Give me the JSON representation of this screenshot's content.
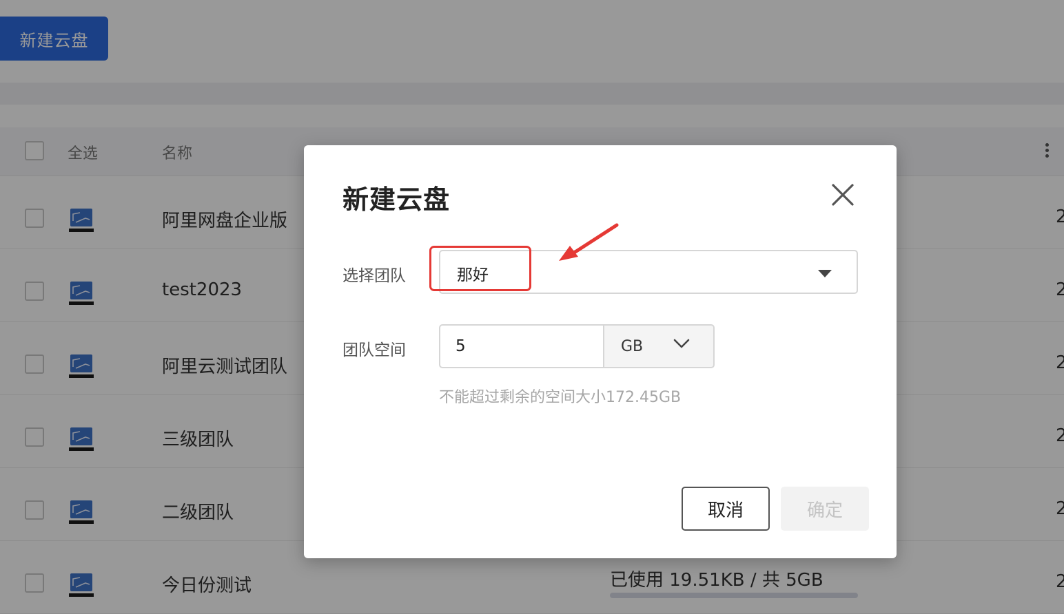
{
  "colors": {
    "primary": "#2d6be0",
    "annotation_red": "#e53935"
  },
  "page": {
    "new_drive_button": "新建云盘",
    "table": {
      "select_all_label": "全选",
      "name_header": "名称",
      "rows": [
        {
          "name": "阿里网盘企业版",
          "edge_text": "2"
        },
        {
          "name": "test2023",
          "edge_text": "2"
        },
        {
          "name": "阿里云测试团队",
          "edge_text": "2"
        },
        {
          "name": "三级团队",
          "edge_text": "2"
        },
        {
          "name": "二级团队",
          "edge_text": "2"
        },
        {
          "name": "今日份测试",
          "edge_text": "2"
        }
      ],
      "last_row_usage": {
        "text": "已使用 19.51KB / 共 5GB",
        "fraction": 0.0
      }
    }
  },
  "modal": {
    "title": "新建云盘",
    "close_icon": "close-icon",
    "team_label": "选择团队",
    "team_value": "那好",
    "space_label": "团队空间",
    "space_value": "5",
    "unit_value": "GB",
    "hint": "不能超过剩余的空间大小172.45GB",
    "cancel_label": "取消",
    "ok_label": "确定"
  }
}
